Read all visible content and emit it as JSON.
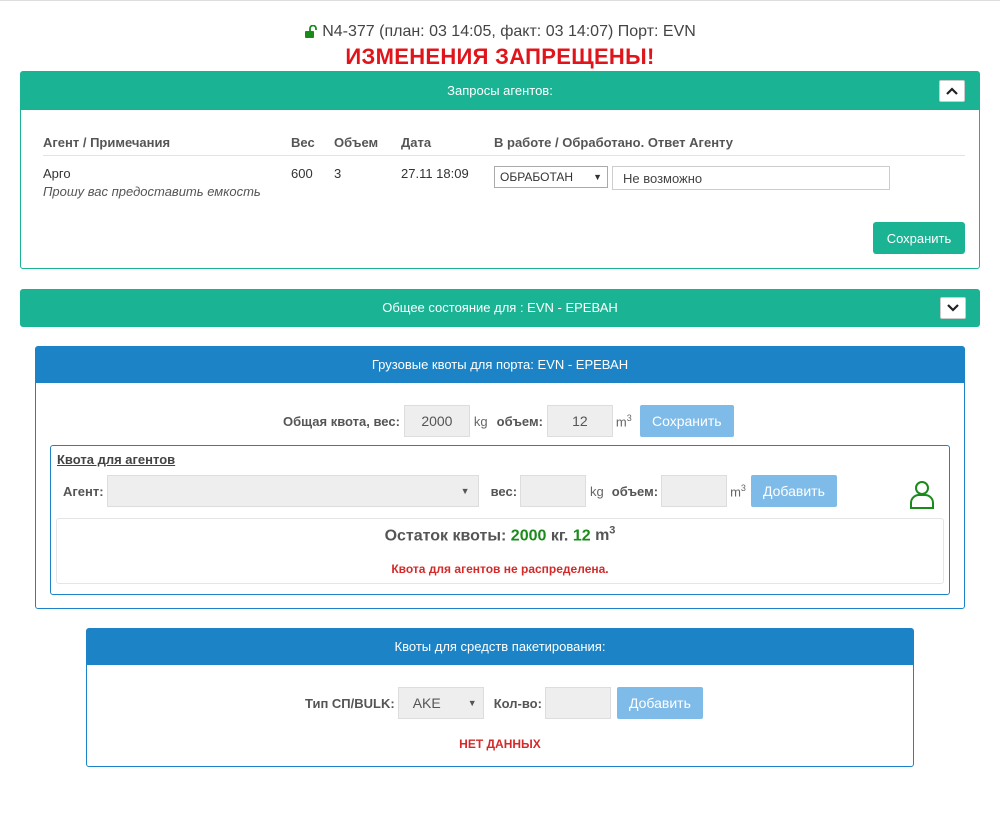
{
  "header": {
    "flight_info": "N4-377 (план: 03 14:05, факт: 03 14:07) Порт: EVN",
    "banner": "ИЗМЕНЕНИЯ ЗАПРЕЩЕНЫ!"
  },
  "agent_requests": {
    "title": "Запросы агентов:",
    "columns": {
      "agent": "Агент / Примечания",
      "weight": "Вес",
      "volume": "Объем",
      "date": "Дата",
      "work": "В работе / Обработано. Ответ Агенту"
    },
    "rows": [
      {
        "agent": "Арго",
        "note": "Прошу вас предоставить емкость",
        "weight": "600",
        "volume": "3",
        "date": "27.11 18:09",
        "status": "ОБРАБОТАН",
        "reply": "Не возможно"
      }
    ],
    "save_label": "Сохранить"
  },
  "general_state": {
    "title": "Общее состояние для : EVN - ЕРЕВАН"
  },
  "cargo_quotas": {
    "title": "Грузовые квоты для порта: EVN - ЕРЕВАН",
    "total_label": "Общая квота, вес:",
    "total_weight": "2000",
    "weight_unit": "kg",
    "volume_label": "объем:",
    "total_volume": "12",
    "volume_unit": "m",
    "volume_unit_exp": "3",
    "save_label": "Сохранить",
    "agent_quota": {
      "title": "Квота для агентов",
      "agent_label": "Агент:",
      "agent_value": "",
      "weight_label": "вес:",
      "weight_value": "",
      "weight_unit": "kg",
      "volume_label": "объем:",
      "volume_value": "",
      "volume_unit": "m",
      "volume_unit_exp": "3",
      "add_label": "Добавить"
    },
    "remainder": {
      "label": "Остаток квоты:",
      "weight": "2000",
      "weight_unit": "кг.",
      "volume": "12",
      "volume_unit": "m",
      "volume_unit_exp": "3",
      "warning": "Квота для агентов не распределена."
    }
  },
  "packaging_quotas": {
    "title": "Квоты для средств пакетирования:",
    "type_label": "Тип СП/BULK:",
    "type_value": "AKE",
    "count_label": "Кол-во:",
    "count_value": "",
    "add_label": "Добавить",
    "no_data": "НЕТ ДАННЫХ"
  },
  "colors": {
    "green": "#1ab394",
    "blue": "#1c84c6",
    "red": "#e0141b"
  }
}
